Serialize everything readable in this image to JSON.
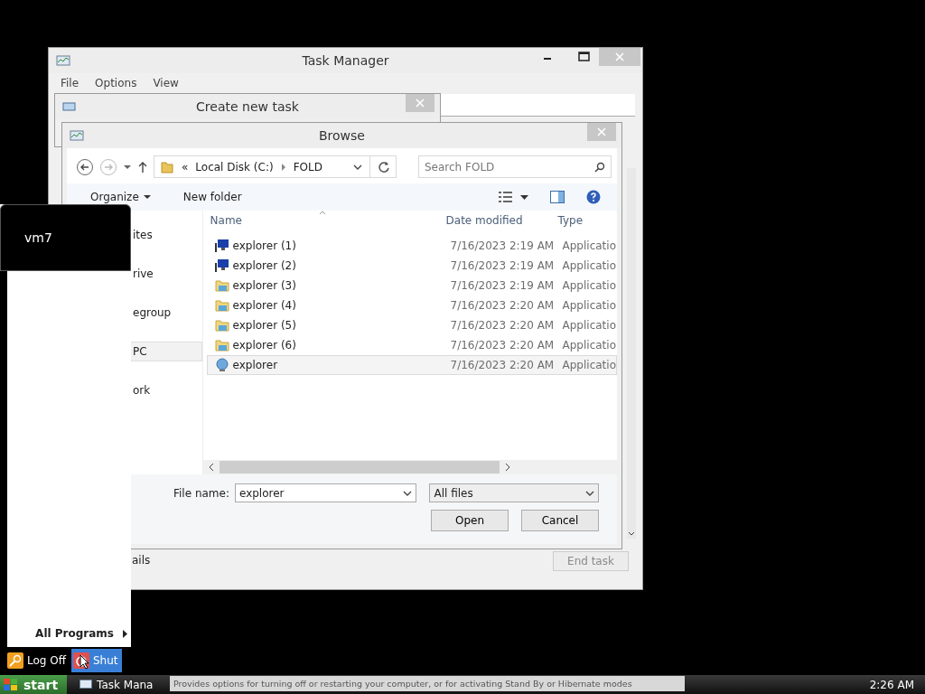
{
  "task_manager": {
    "title": "Task Manager",
    "menu": [
      "File",
      "Options",
      "View"
    ],
    "details_link": "ails",
    "end_task": {
      "label": "End task",
      "disabled": true
    }
  },
  "create_task": {
    "title": "Create new task"
  },
  "browse": {
    "title": "Browse",
    "address": {
      "prefix": "«",
      "segments": [
        "Local Disk (C:)",
        "FOLD"
      ]
    },
    "search": {
      "placeholder": "Search FOLD"
    },
    "toolbar": [
      "Organize",
      "New folder"
    ],
    "nav": [
      {
        "label": "ites",
        "selected": false
      },
      {
        "label": "rive",
        "selected": false
      },
      {
        "label": "egroup",
        "selected": false
      },
      {
        "label": "PC",
        "selected": true
      },
      {
        "label": "ork",
        "selected": false
      }
    ],
    "columns": [
      "Name",
      "Date modified",
      "Type"
    ],
    "files": [
      {
        "name": "explorer (1)",
        "date": "7/16/2023 2:19 AM",
        "type": "Applicatio",
        "kind": "monitor",
        "selected": false
      },
      {
        "name": "explorer (2)",
        "date": "7/16/2023 2:19 AM",
        "type": "Applicatio",
        "kind": "monitor",
        "selected": false
      },
      {
        "name": "explorer (3)",
        "date": "7/16/2023 2:19 AM",
        "type": "Applicatio",
        "kind": "folder",
        "selected": false
      },
      {
        "name": "explorer (4)",
        "date": "7/16/2023 2:20 AM",
        "type": "Applicatio",
        "kind": "folder",
        "selected": false
      },
      {
        "name": "explorer (5)",
        "date": "7/16/2023 2:20 AM",
        "type": "Applicatio",
        "kind": "folder",
        "selected": false
      },
      {
        "name": "explorer (6)",
        "date": "7/16/2023 2:20 AM",
        "type": "Applicatio",
        "kind": "folder",
        "selected": false
      },
      {
        "name": "explorer",
        "date": "7/16/2023 2:20 AM",
        "type": "Applicatio",
        "kind": "globe",
        "selected": true
      }
    ],
    "file_name": {
      "label": "File name:",
      "value": "explorer"
    },
    "filter": "All files",
    "buttons": [
      "Open",
      "Cancel"
    ]
  },
  "start_menu": {
    "user": "vm7",
    "all_programs": "All Programs",
    "log_off": "Log Off",
    "shut": "Shut"
  },
  "taskbar": {
    "start": "start",
    "items": [
      {
        "label": "Task Mana"
      }
    ],
    "tooltip": "Provides options for turning off or restarting your computer, or for activating Stand By or Hibernate modes",
    "clock": "2:26 AM"
  }
}
